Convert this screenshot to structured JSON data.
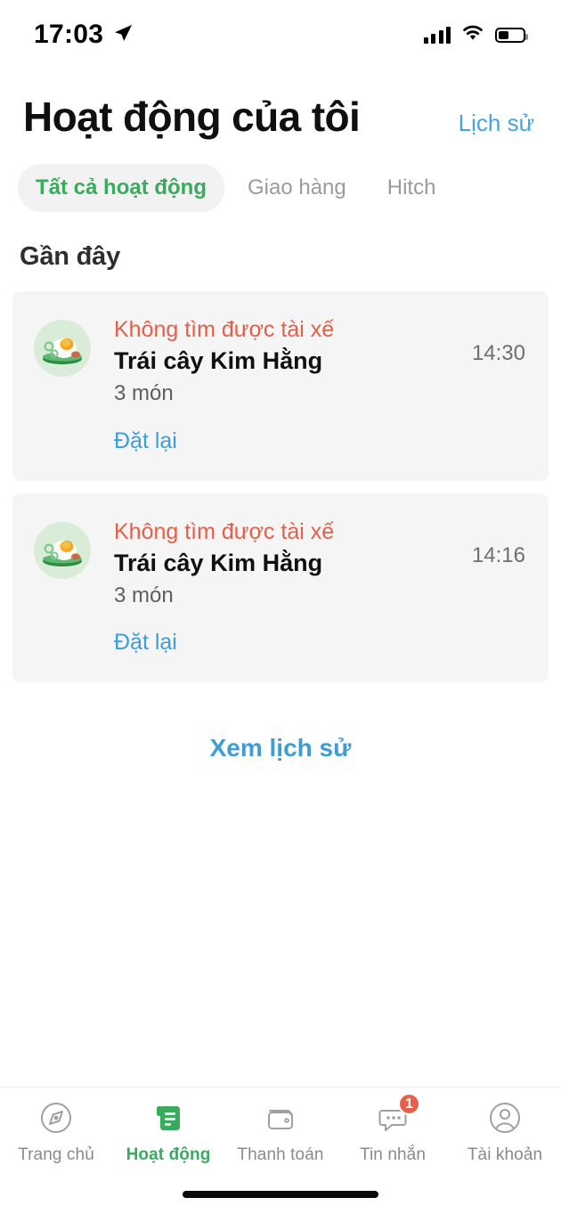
{
  "status_bar": {
    "time": "17:03",
    "location_icon": "location-arrow-icon",
    "signal_icon": "cellular-signal-icon",
    "wifi_icon": "wifi-icon",
    "battery_icon": "battery-icon"
  },
  "header": {
    "title": "Hoạt động của tôi",
    "history_link": "Lịch sử"
  },
  "tabs": [
    {
      "label": "Tất cả hoạt động",
      "active": true
    },
    {
      "label": "Giao hàng",
      "active": false
    },
    {
      "label": "Hitch",
      "active": false
    }
  ],
  "section": {
    "recent_title": "Gần đây"
  },
  "activities": [
    {
      "status": "Không tìm được tài xế",
      "merchant": "Trái cây Kim Hằng",
      "items": "3 món",
      "action": "Đặt lại",
      "time": "14:30",
      "thumb_icon": "fried-egg-dish-icon"
    },
    {
      "status": "Không tìm được tài xế",
      "merchant": "Trái cây Kim Hằng",
      "items": "3 món",
      "action": "Đặt lại",
      "time": "14:16",
      "thumb_icon": "fried-egg-dish-icon"
    }
  ],
  "view_history": "Xem lịch sử",
  "bottom_nav": [
    {
      "label": "Trang chủ",
      "icon": "compass-icon",
      "active": false,
      "badge": ""
    },
    {
      "label": "Hoạt động",
      "icon": "receipt-icon",
      "active": true,
      "badge": ""
    },
    {
      "label": "Thanh toán",
      "icon": "wallet-icon",
      "active": false,
      "badge": ""
    },
    {
      "label": "Tin nhắn",
      "icon": "chat-bubble-icon",
      "active": false,
      "badge": "1"
    },
    {
      "label": "Tài khoản",
      "icon": "user-circle-icon",
      "active": false,
      "badge": ""
    }
  ],
  "colors": {
    "brand_green": "#3aab5d",
    "link_blue": "#3d9ed6",
    "status_red": "#e2604a",
    "card_bg": "#f5f5f5",
    "badge_red": "#e9604a"
  }
}
